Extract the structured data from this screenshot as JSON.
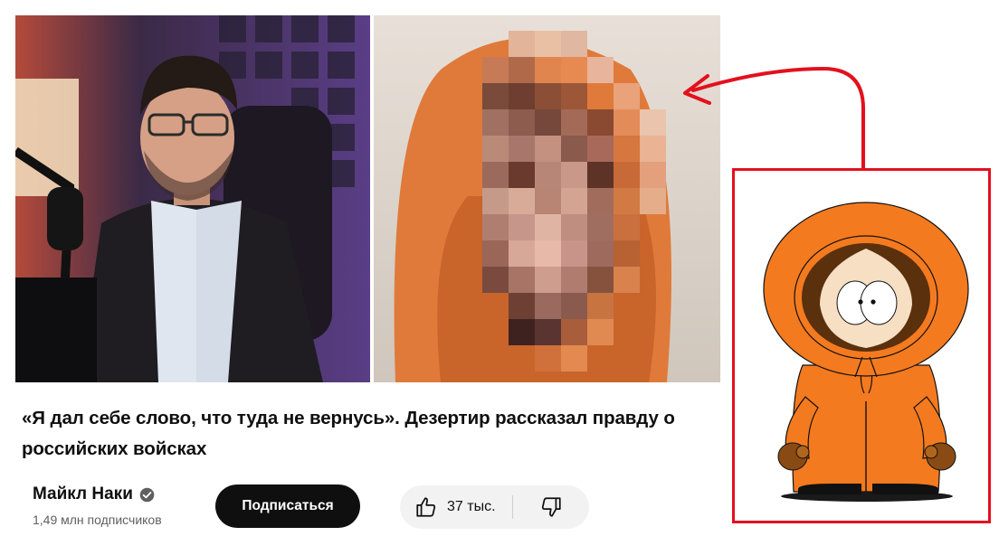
{
  "video": {
    "title": "«Я дал себе слово, что туда не вернусь». Дезертир рассказал правду о российских войсках"
  },
  "channel": {
    "name": "Майкл Наки",
    "subscribers": "1,49 млн подписчиков",
    "verified": true
  },
  "actions": {
    "subscribe_label": "Подписаться",
    "like_count": "37 тыс."
  },
  "icons": {
    "verified": "verified-badge-icon",
    "like": "thumbs-up-icon",
    "dislike": "thumbs-down-icon"
  },
  "colors": {
    "annotation_red": "#e3101d",
    "subscribe_bg": "#0f0f0f",
    "like_bar_bg": "#f2f2f2",
    "hoodie_orange": "#f47a1f"
  }
}
